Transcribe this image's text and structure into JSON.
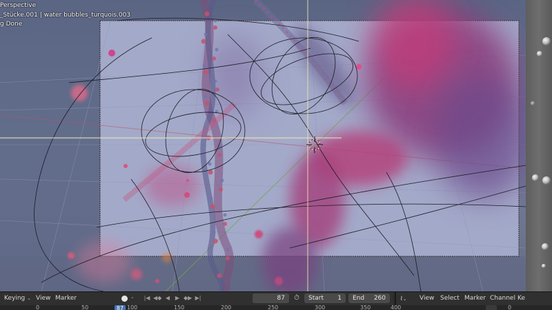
{
  "viewport": {
    "view_name": "Perspective",
    "collection_info": "_Stücke.001 | water bubbles_turquois.003",
    "status": "g Done"
  },
  "timeline": {
    "keying_label": "Keying",
    "view_label": "View",
    "marker_label": "Marker",
    "current_frame": "87",
    "start_label": "Start",
    "start_value": "1",
    "end_label": "End",
    "end_value": "260",
    "ruler_ticks": [
      "0",
      "50",
      "100",
      "150",
      "200",
      "250",
      "300",
      "350",
      "400"
    ],
    "playhead_frame": "87"
  },
  "graph_editor": {
    "view_label": "View",
    "select_label": "Select",
    "marker_label": "Marker",
    "channel_label": "Channel",
    "key_label": "Ke",
    "ruler_ticks": [
      "0"
    ]
  },
  "icons": {
    "keyframe": "keyframe-dot-icon",
    "jump_start": "jump-to-start-icon",
    "prev_key": "previous-keyframe-icon",
    "play_reverse": "play-reverse-icon",
    "play": "play-icon",
    "next_key": "next-keyframe-icon",
    "jump_end": "jump-to-end-icon",
    "stopwatch": "stopwatch-icon",
    "graph_editor": "graph-editor-icon"
  },
  "colors": {
    "accent": "#4772b3",
    "viewport_bg": "#6a7593",
    "camera_frame_bg": "#a3a9c9",
    "pink": "#d0366d"
  }
}
